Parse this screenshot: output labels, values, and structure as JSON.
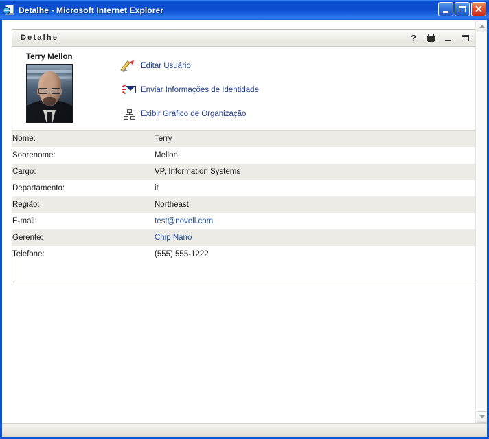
{
  "window": {
    "title": "Detalhe - Microsoft Internet Explorer",
    "icon": "ie-document-icon",
    "buttons": {
      "minimize": "_",
      "maximize": "□",
      "close": "✕"
    }
  },
  "portlet": {
    "title": "Detalhe",
    "tools": [
      {
        "name": "help-icon",
        "label": "?"
      },
      {
        "name": "print-icon",
        "label": ""
      },
      {
        "name": "minimize-icon",
        "label": ""
      },
      {
        "name": "maximize-icon",
        "label": ""
      }
    ]
  },
  "identity": {
    "name": "Terry Mellon",
    "photo_alt": "Terry Mellon"
  },
  "actions": [
    {
      "icon": "pencil-icon",
      "label": "Editar Usuário"
    },
    {
      "icon": "envelope-icon",
      "label": "Enviar Informações de Identidade"
    },
    {
      "icon": "orgchart-icon",
      "label": "Exibir Gráfico de Organização"
    }
  ],
  "details": [
    {
      "label": "Nome:",
      "value": "Terry",
      "link": false
    },
    {
      "label": "Sobrenome:",
      "value": "Mellon",
      "link": false
    },
    {
      "label": "Cargo:",
      "value": "VP, Information Systems",
      "link": false
    },
    {
      "label": "Departamento:",
      "value": "it",
      "link": false
    },
    {
      "label": "Região:",
      "value": "Northeast",
      "link": false
    },
    {
      "label": "E-mail:",
      "value": "test@novell.com",
      "link": true
    },
    {
      "label": "Gerente:",
      "value": "Chip Nano",
      "link": true
    },
    {
      "label": "Telefone:",
      "value": "(555) 555-1222",
      "link": false
    }
  ],
  "colors": {
    "titlebar_blue": "#0b4ccf",
    "link_blue": "#1f4fa0",
    "row_stripe": "#edece7",
    "panel_border": "#b9b9ad"
  }
}
